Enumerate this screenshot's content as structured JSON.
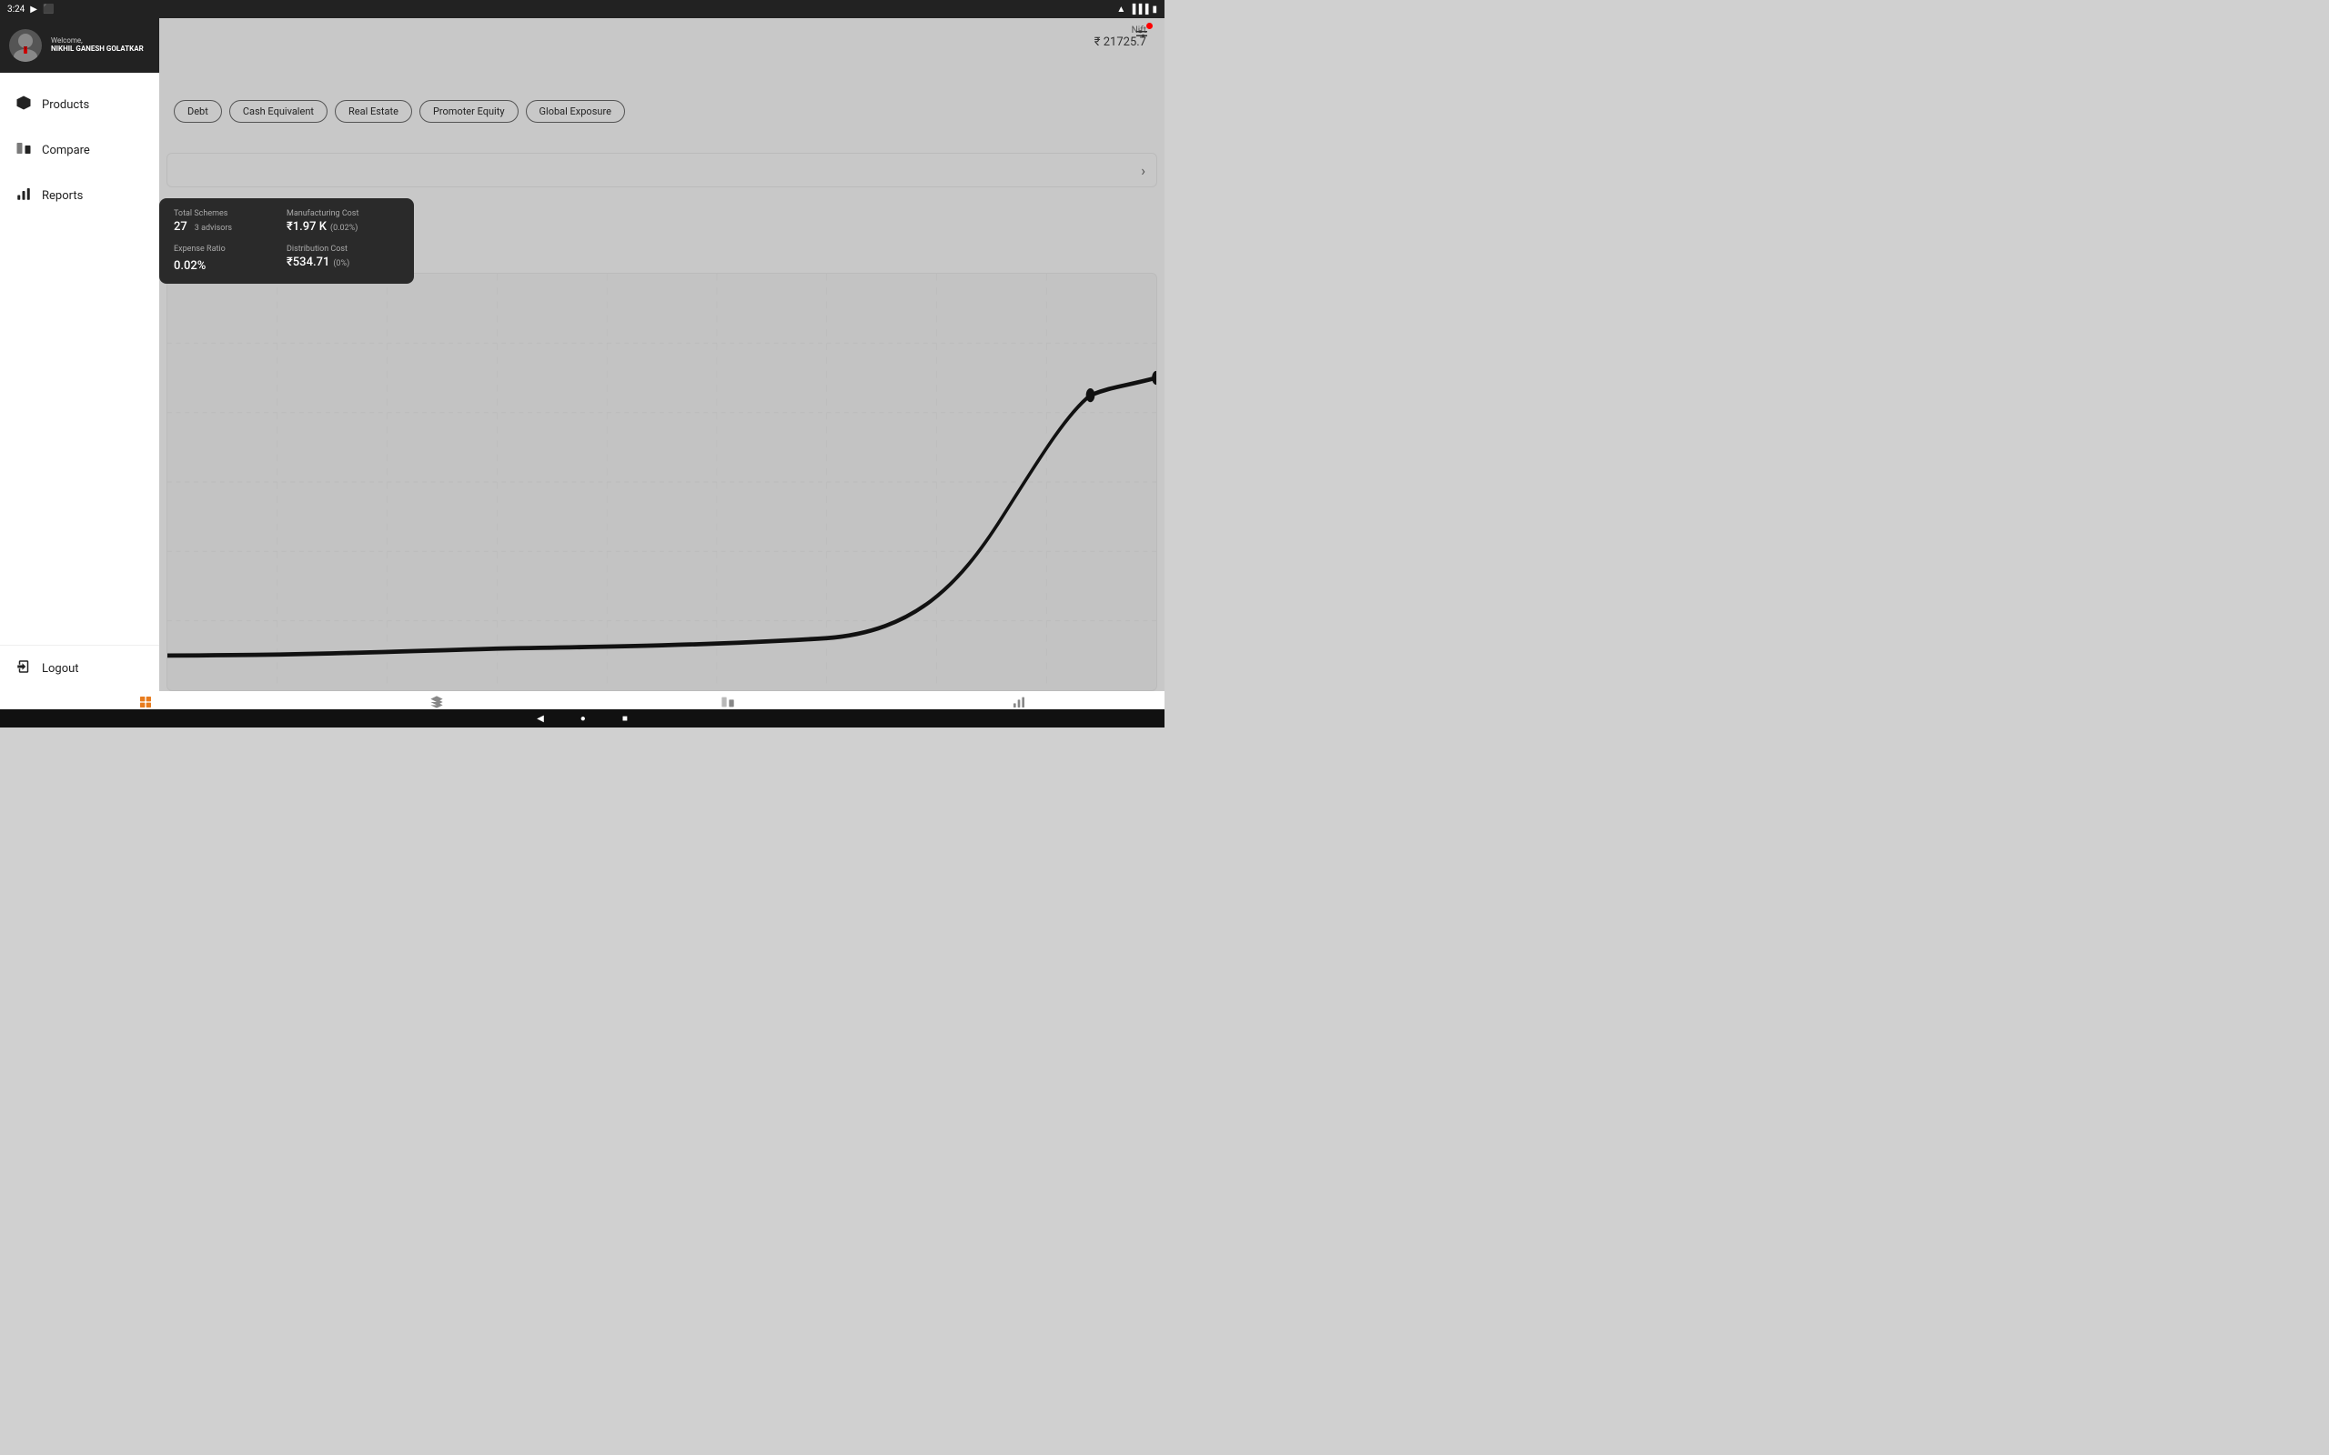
{
  "statusBar": {
    "time": "3:24",
    "icons": [
      "play",
      "screenshot"
    ]
  },
  "sidebar": {
    "welcome": "Welcome,",
    "userName": "NIKHIL GANESH GOLATKAR",
    "items": [
      {
        "id": "products",
        "label": "Products"
      },
      {
        "id": "compare",
        "label": "Compare"
      },
      {
        "id": "reports",
        "label": "Reports"
      }
    ],
    "logout": "Logout"
  },
  "ticker": {
    "label": "Nift",
    "value": "₹ 21725.7"
  },
  "filterChips": [
    {
      "id": "debt",
      "label": "Debt"
    },
    {
      "id": "cash-equivalent",
      "label": "Cash Equivalent"
    },
    {
      "id": "real-estate",
      "label": "Real Estate"
    },
    {
      "id": "promoter-equity",
      "label": "Promoter Equity"
    },
    {
      "id": "global-exposure",
      "label": "Global Exposure"
    }
  ],
  "stats": {
    "totalSchemesLabel": "Total Schemes",
    "totalSchemesValue": "27",
    "advisorsValue": "3 advisors",
    "manufacturingCostLabel": "Manufacturing Cost",
    "manufacturingCostValue": "₹1.97 K",
    "manufacturingCostSub": "(0.02%)",
    "expenseRatioLabel": "Expense Ratio",
    "expenseRatioValue": "0.02%",
    "distributionCostLabel": "Distribution Cost",
    "distributionCostValue": "₹534.71",
    "distributionCostSub": "(0%)"
  },
  "bottomNav": [
    {
      "id": "dashboard",
      "label": "Dashboard",
      "active": true
    },
    {
      "id": "products",
      "label": "Products",
      "active": false
    },
    {
      "id": "compare",
      "label": "Compare",
      "active": false
    },
    {
      "id": "report",
      "label": "Report",
      "active": false
    }
  ],
  "androidNav": {
    "back": "◀",
    "home": "●",
    "recent": "■"
  }
}
